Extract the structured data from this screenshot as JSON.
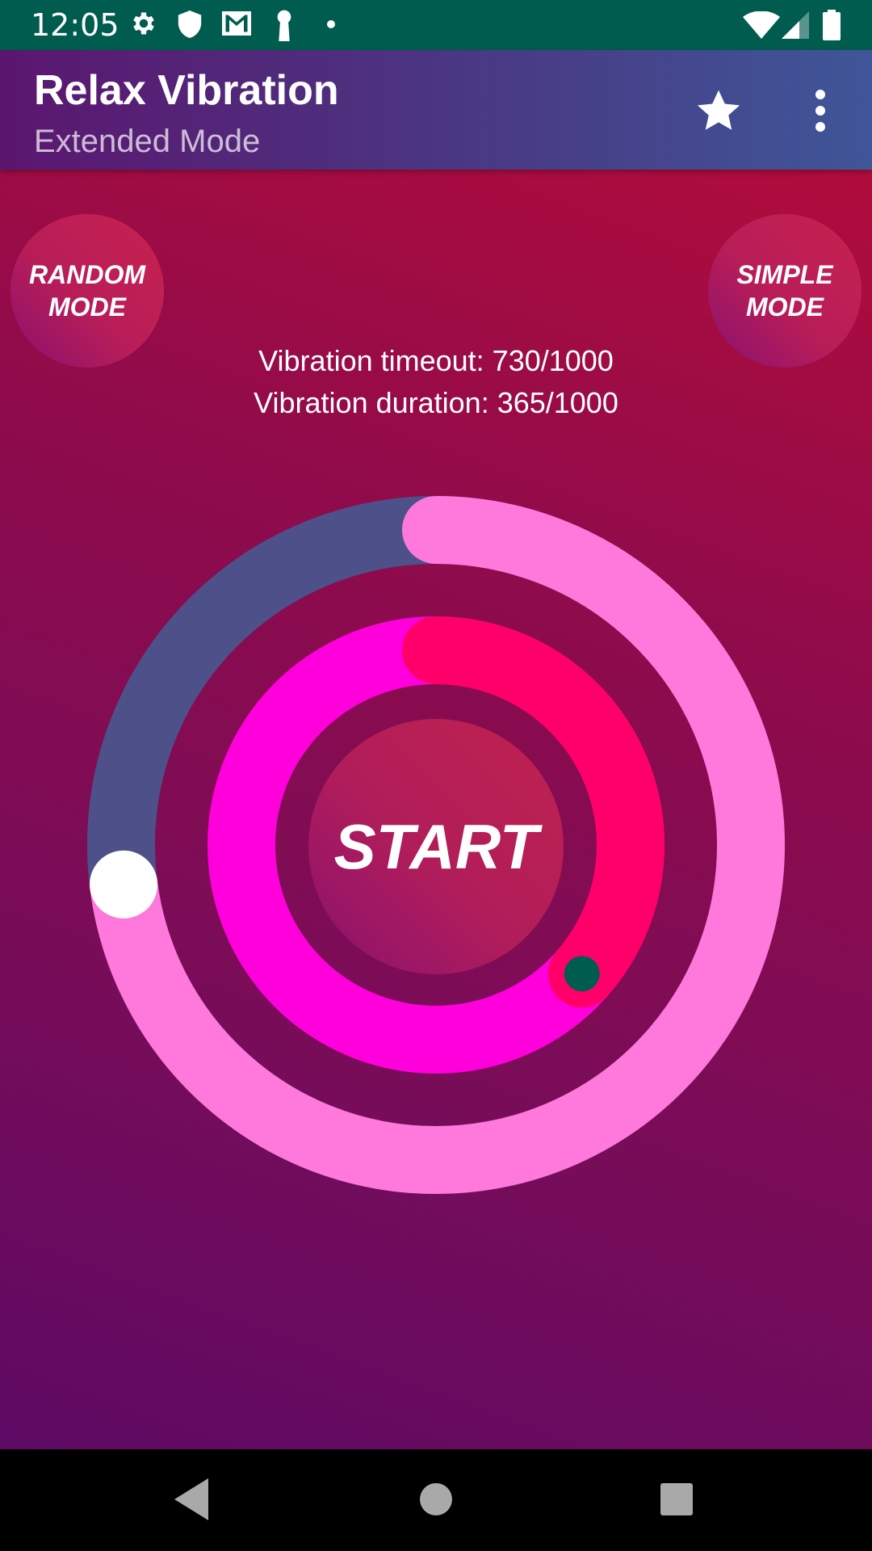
{
  "status_bar": {
    "time": "12:05",
    "left_icons": [
      "gear-icon",
      "shield-icon",
      "gmail-icon",
      "keyhole-icon",
      "dot-icon"
    ],
    "right_icons": [
      "wifi-icon",
      "cell-signal-icon",
      "battery-icon"
    ]
  },
  "app_bar": {
    "title": "Relax Vibration",
    "subtitle": "Extended Mode",
    "actions": [
      "star-icon",
      "more-vert-icon"
    ]
  },
  "modes": {
    "random_label": "RANDOM\nMODE",
    "simple_label": "SIMPLE\nMODE"
  },
  "info": {
    "timeout_text": "Vibration timeout: 730/1000",
    "duration_text": "Vibration duration: 365/1000"
  },
  "controls": {
    "timeout_value": 730,
    "timeout_max": 1000,
    "duration_value": 365,
    "duration_max": 1000,
    "start_label": "START"
  },
  "colors": {
    "status_bar": "#005c4f",
    "outer_track": "#4d5089",
    "outer_progress": "#ff78dc",
    "inner_track": "#ff00dc",
    "inner_progress": "#ff006a",
    "thumb_outer": "#ffffff",
    "thumb_inner": "#005c4f"
  }
}
